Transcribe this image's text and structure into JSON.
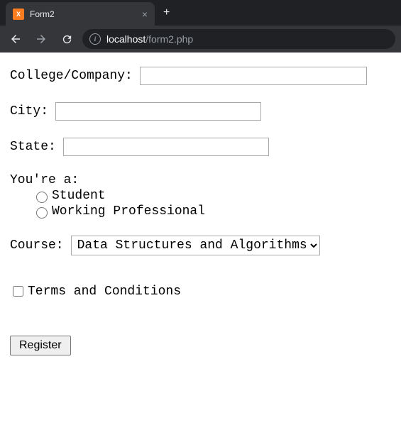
{
  "browser": {
    "tab_title": "Form2",
    "url_host": "localhost",
    "url_path": "/form2.php"
  },
  "form": {
    "college_label": "College/Company:",
    "college_value": "",
    "city_label": "City:",
    "city_value": "",
    "state_label": "State:",
    "state_value": "",
    "role_label": "You're a:",
    "role_options": {
      "student": "Student",
      "working": "Working Professional"
    },
    "course_label": "Course:",
    "course_selected": "Data Structures and Algorithms",
    "terms_label": "Terms and Conditions",
    "register_label": "Register"
  }
}
